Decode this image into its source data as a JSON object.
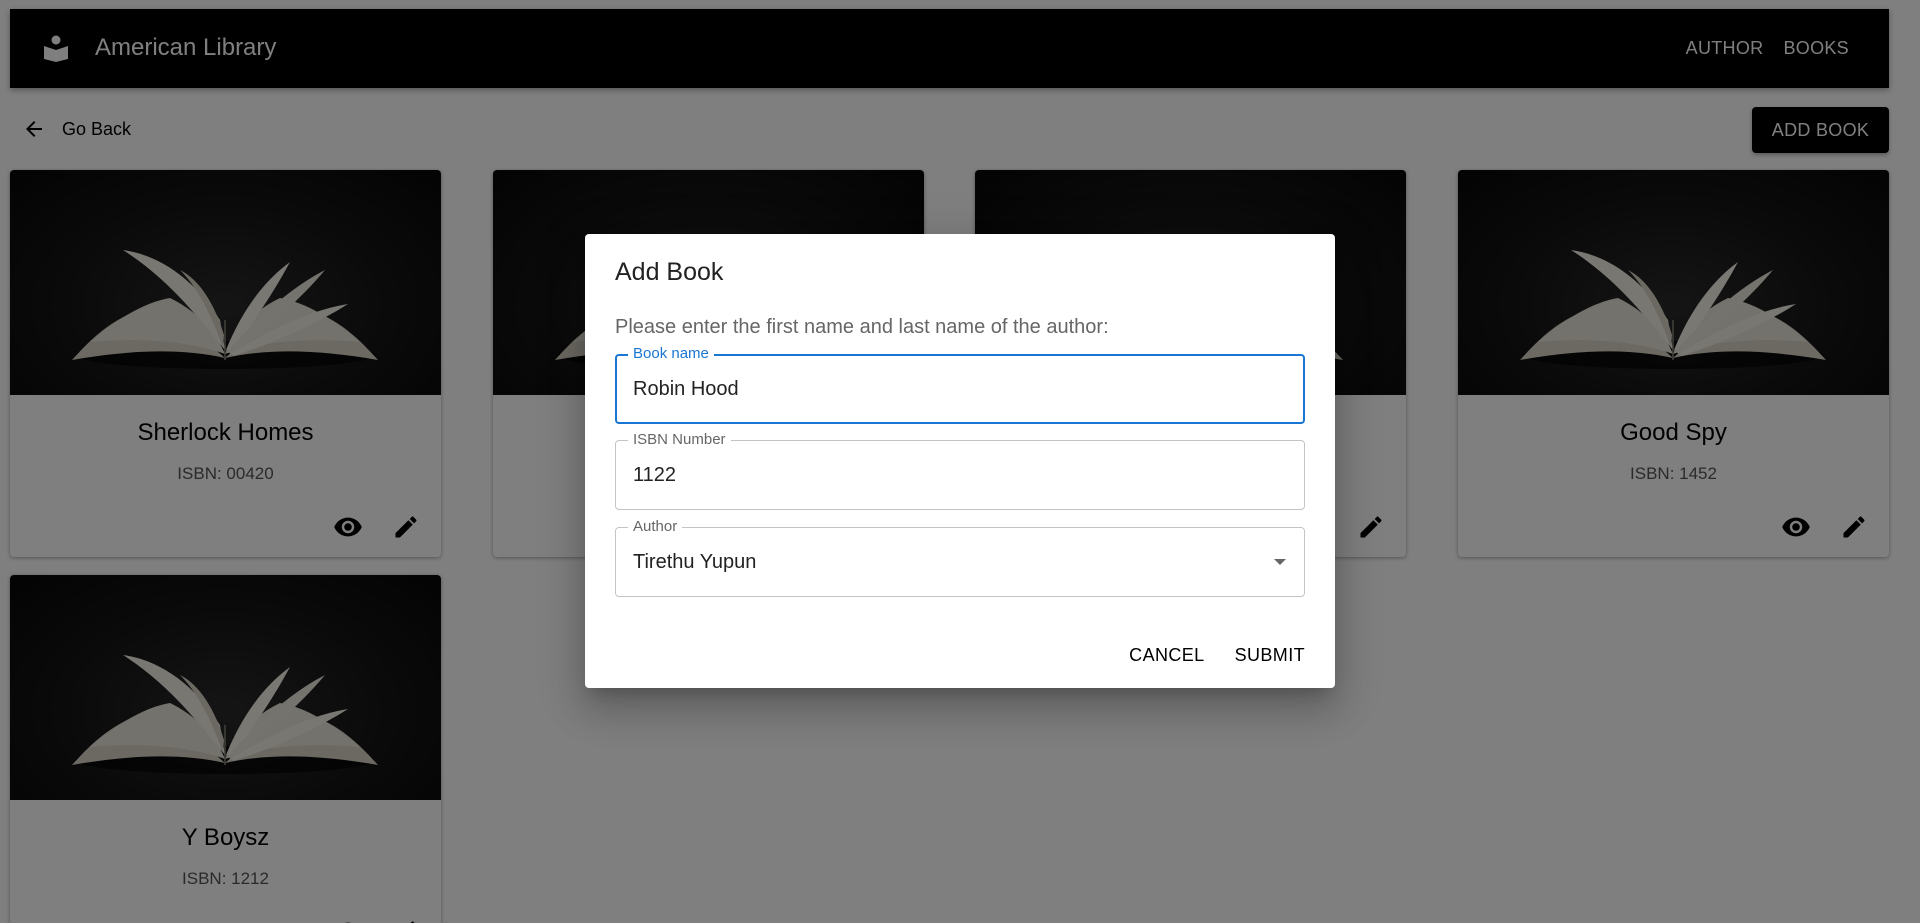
{
  "appbar": {
    "icon": "book-person-icon",
    "title": "American Library",
    "nav": [
      {
        "label": "AUTHOR"
      },
      {
        "label": "BOOKS"
      }
    ]
  },
  "toolbar": {
    "go_back_icon": "arrow-left-icon",
    "go_back_label": "Go Back",
    "add_book_label": "ADD BOOK"
  },
  "books": [
    {
      "title": "Sherlock Homes",
      "isbn": "ISBN: 00420"
    },
    {
      "title": "",
      "isbn": ""
    },
    {
      "title": "",
      "isbn": ""
    },
    {
      "title": "Good Spy",
      "isbn": "ISBN: 1452"
    },
    {
      "title": "Y Boysz",
      "isbn": "ISBN: 1212"
    }
  ],
  "card_actions": {
    "view_icon": "eye-icon",
    "edit_icon": "pencil-icon"
  },
  "dialog": {
    "title": "Add Book",
    "text": "Please enter the first name and last name of the author:",
    "book_name": {
      "label": "Book name",
      "value": "Robin Hood"
    },
    "isbn": {
      "label": "ISBN Number",
      "value": "1122"
    },
    "author": {
      "label": "Author",
      "value": "Tirethu Yupun",
      "icon": "caret-down-icon"
    },
    "cancel_label": "CANCEL",
    "submit_label": "SUBMIT"
  },
  "colors": {
    "appbar": "#000000",
    "accent": "#1976d2",
    "backdrop": "rgba(0,0,0,0.5)"
  }
}
